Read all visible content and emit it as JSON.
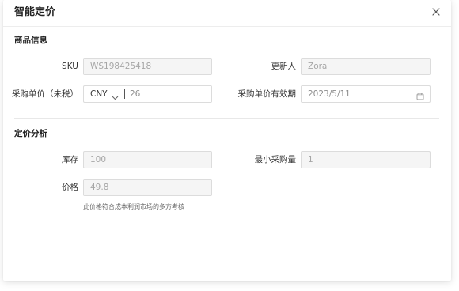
{
  "dialog": {
    "title": "智能定价",
    "close_icon": "close-icon"
  },
  "sections": {
    "product_info": "商品信息",
    "pricing_analysis": "定价分析"
  },
  "fields": {
    "sku": {
      "label": "SKU",
      "value": "WS198425418"
    },
    "updater": {
      "label": "更新人",
      "value": "Zora"
    },
    "purchase_price": {
      "label": "采购单价（未税）",
      "currency": "CNY",
      "value": "26"
    },
    "validity": {
      "label": "采购单价有效期",
      "value": "2023/5/11",
      "icon": "calendar-icon"
    },
    "stock": {
      "label": "库存",
      "value": "100"
    },
    "min_qty": {
      "label": "最小采购量",
      "value": "1"
    },
    "price": {
      "label": "价格",
      "value": "49.8",
      "hint": "此价格符合成本利润市场的多方考核"
    }
  }
}
